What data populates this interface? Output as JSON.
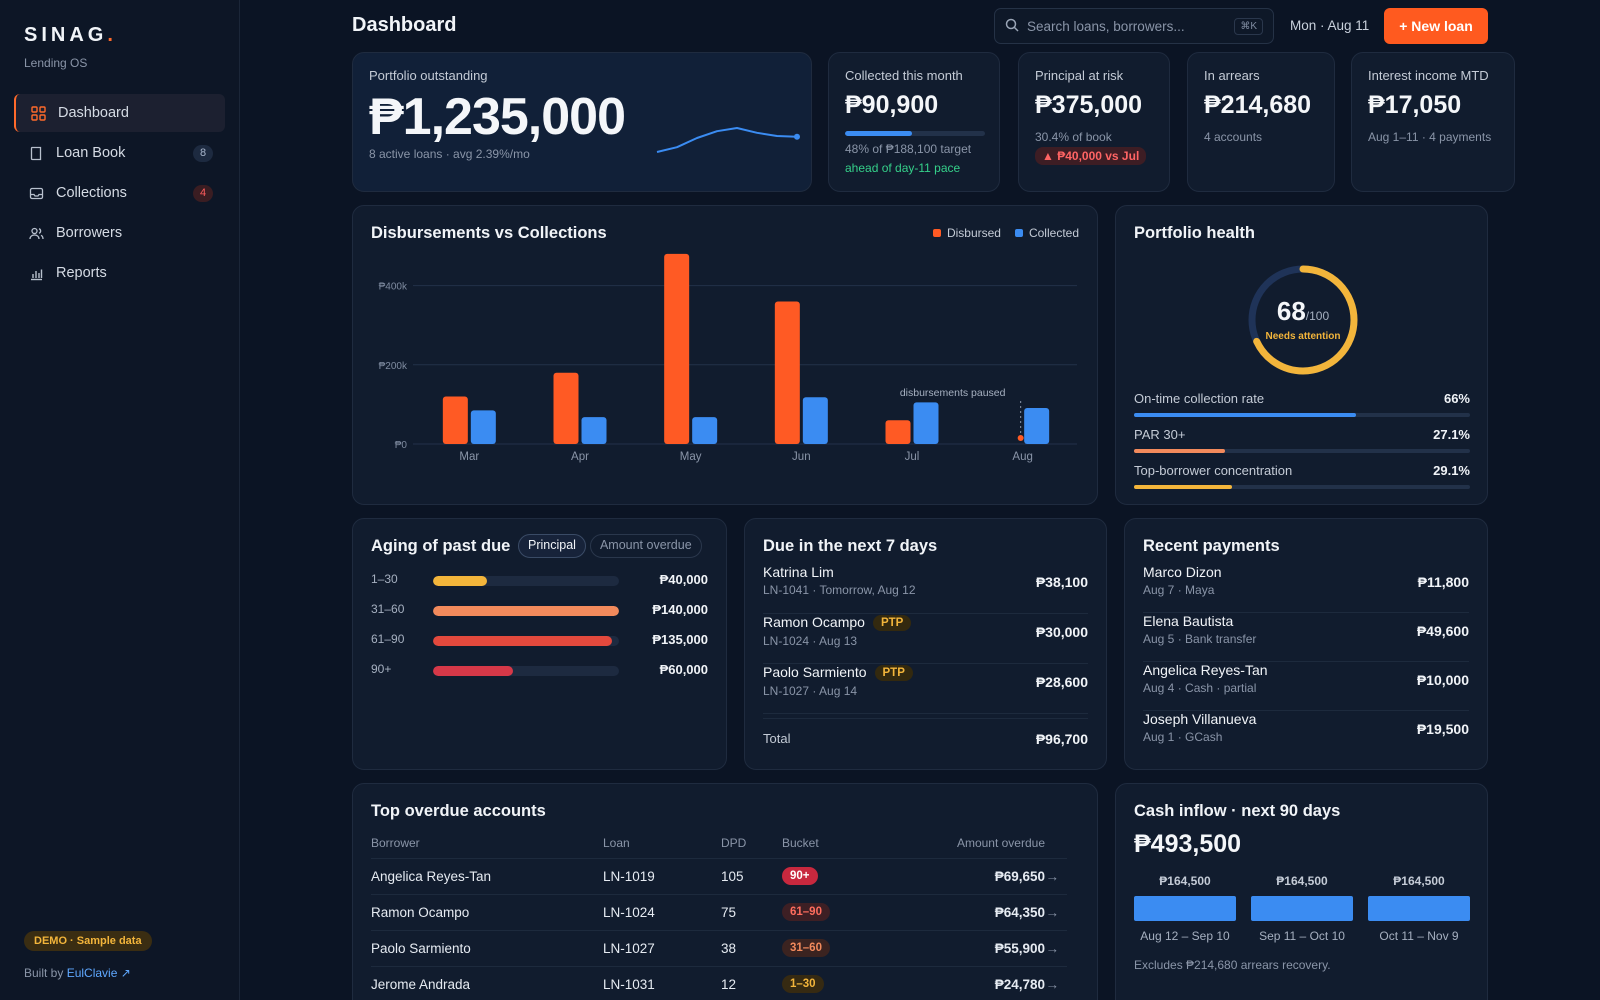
{
  "brand": {
    "name": "SINAG",
    "dot": ".",
    "subtitle": "Lending OS"
  },
  "sidebar": {
    "items": [
      {
        "label": "Dashboard",
        "icon": "grid-icon",
        "active": true
      },
      {
        "label": "Loan Book",
        "icon": "book-icon",
        "badge": "8"
      },
      {
        "label": "Collections",
        "icon": "inbox-icon",
        "badge": "4"
      },
      {
        "label": "Borrowers",
        "icon": "users-icon"
      },
      {
        "label": "Reports",
        "icon": "bar-chart-icon"
      }
    ],
    "demo_badge": "DEMO · Sample data",
    "built_by_prefix": "Built by",
    "built_by_link": "EulClavie ↗"
  },
  "header": {
    "title": "Dashboard",
    "search_placeholder": "Search loans, borrowers...",
    "search_shortcut": "⌘K",
    "date": "Mon · Aug 11",
    "new_loan_label": "+ New loan"
  },
  "kpis": {
    "portfolio": {
      "label": "Portfolio outstanding",
      "value": "₱1,235,000",
      "sub": "8 active loans · avg 2.39%/mo",
      "sparkline": [
        0.1,
        0.22,
        0.45,
        0.62,
        0.7,
        0.58,
        0.5,
        0.48
      ]
    },
    "collected": {
      "label": "Collected this month",
      "value": "₱90,900",
      "progress": 0.48,
      "sub": "48% of ₱188,100 target",
      "pace": "ahead of day-11 pace"
    },
    "risk": {
      "label": "Principal at risk",
      "value": "₱375,000",
      "sub": "30.4% of book",
      "delta": "▲ ₱40,000 vs Jul"
    },
    "arrears": {
      "label": "In arrears",
      "value": "₱214,680",
      "sub": "4 accounts"
    },
    "interest": {
      "label": "Interest income MTD",
      "value": "₱17,050",
      "sub": "Aug 1–11 · 4 payments"
    }
  },
  "disb_chart": {
    "title": "Disbursements vs Collections",
    "legend": {
      "disbursed": "Disbursed",
      "collected": "Collected"
    },
    "annotation": "disbursements paused",
    "colors": {
      "disbursed": "#ff5a24",
      "collected": "#3b8cf2"
    }
  },
  "chart_data": {
    "type": "bar",
    "title": "Disbursements vs Collections",
    "categories": [
      "Mar",
      "Apr",
      "May",
      "Jun",
      "Jul",
      "Aug"
    ],
    "series": [
      {
        "name": "Disbursed",
        "values": [
          120000,
          180000,
          480000,
          360000,
          60000,
          0
        ]
      },
      {
        "name": "Collected",
        "values": [
          85000,
          68000,
          68000,
          118000,
          105000,
          90900
        ]
      }
    ],
    "ylim": [
      0,
      500000
    ],
    "yticks": [
      {
        "value": 0,
        "label": "₱0"
      },
      {
        "value": 200000,
        "label": "₱200k"
      },
      {
        "value": 400000,
        "label": "₱400k"
      }
    ],
    "grid": true,
    "legend_position": "top-right"
  },
  "health": {
    "title": "Portfolio health",
    "score": "68",
    "score_max": "/100",
    "score_fraction": 0.68,
    "status": "Needs attention",
    "metrics": [
      {
        "label": "On-time collection rate",
        "value": "66%",
        "fraction": 0.66,
        "color": "#3b8cf2"
      },
      {
        "label": "PAR 30+",
        "value": "27.1%",
        "fraction": 0.271,
        "color": "#f28a5c"
      },
      {
        "label": "Top-borrower concentration",
        "value": "29.1%",
        "fraction": 0.291,
        "color": "#f3b53b"
      }
    ]
  },
  "aging": {
    "title": "Aging of past due",
    "toggle": [
      "Principal",
      "Amount overdue"
    ],
    "rows": [
      {
        "bucket": "1–30",
        "amount": "₱40,000",
        "fraction": 0.29,
        "color": "#f3b53b"
      },
      {
        "bucket": "31–60",
        "amount": "₱140,000",
        "fraction": 1.0,
        "color": "#f28a5c"
      },
      {
        "bucket": "61–90",
        "amount": "₱135,000",
        "fraction": 0.96,
        "color": "#e3493d"
      },
      {
        "bucket": "90+",
        "amount": "₱60,000",
        "fraction": 0.43,
        "color": "#d63848"
      }
    ]
  },
  "due": {
    "title": "Due in the next 7 days",
    "rows": [
      {
        "name": "Katrina Lim",
        "sub": "LN-1041 · Tomorrow, Aug 12",
        "amount": "₱38,100",
        "tag": ""
      },
      {
        "name": "Ramon Ocampo",
        "sub": "LN-1024 · Aug 13",
        "amount": "₱30,000",
        "tag": "PTP"
      },
      {
        "name": "Paolo Sarmiento",
        "sub": "LN-1027 · Aug 14",
        "amount": "₱28,600",
        "tag": "PTP"
      }
    ],
    "total_label": "Total",
    "total_amount": "₱96,700"
  },
  "payments": {
    "title": "Recent payments",
    "rows": [
      {
        "name": "Marco Dizon",
        "sub": "Aug 7 · Maya",
        "amount": "₱11,800"
      },
      {
        "name": "Elena Bautista",
        "sub": "Aug 5 · Bank transfer",
        "amount": "₱49,600"
      },
      {
        "name": "Angelica Reyes-Tan",
        "sub": "Aug 4 · Cash · partial",
        "amount": "₱10,000"
      },
      {
        "name": "Joseph Villanueva",
        "sub": "Aug 1 · GCash",
        "amount": "₱19,500"
      }
    ]
  },
  "overdue": {
    "title": "Top overdue accounts",
    "columns": [
      "Borrower",
      "Loan",
      "DPD",
      "Bucket",
      "Amount overdue"
    ],
    "rows": [
      {
        "borrower": "Angelica Reyes-Tan",
        "loan": "LN-1019",
        "dpd": "105",
        "bucket": "90+",
        "amount": "₱69,650",
        "bucket_bg": "#c8283e",
        "bucket_fg": "#ffffff"
      },
      {
        "borrower": "Ramon Ocampo",
        "loan": "LN-1024",
        "dpd": "75",
        "bucket": "61–90",
        "amount": "₱64,350",
        "bucket_bg": "#3d1f24",
        "bucket_fg": "#ff6d5e"
      },
      {
        "borrower": "Paolo Sarmiento",
        "loan": "LN-1027",
        "dpd": "38",
        "bucket": "31–60",
        "amount": "₱55,900",
        "bucket_bg": "#3b2320",
        "bucket_fg": "#f28a5c"
      },
      {
        "borrower": "Jerome Andrada",
        "loan": "LN-1031",
        "dpd": "12",
        "bucket": "1–30",
        "amount": "₱24,780",
        "bucket_bg": "#362a12",
        "bucket_fg": "#f3b53b"
      }
    ],
    "row_arrow": "→"
  },
  "cash": {
    "title": "Cash inflow · next 90 days",
    "total": "₱493,500",
    "periods": [
      {
        "amount": "₱164,500",
        "label": "Aug 12 – Sep 10"
      },
      {
        "amount": "₱164,500",
        "label": "Sep 11 – Oct 10"
      },
      {
        "amount": "₱164,500",
        "label": "Oct 11 – Nov 9"
      }
    ],
    "note": "Excludes ₱214,680 arrears recovery."
  }
}
